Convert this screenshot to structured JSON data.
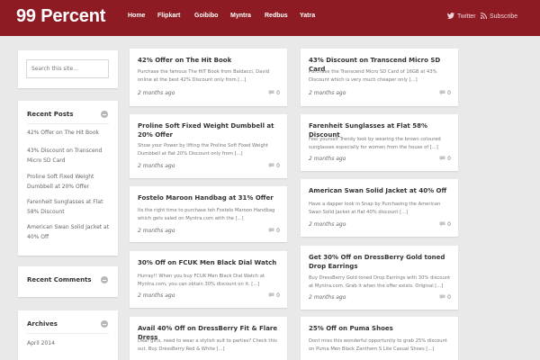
{
  "site": {
    "title": "99 Percent"
  },
  "nav": [
    "Home",
    "Flipkart",
    "Goibibo",
    "Myntra",
    "Redbus",
    "Yatra"
  ],
  "social": {
    "twitter": "Twitter",
    "subscribe": "Subscribe"
  },
  "colors": {
    "header": "#8e1b23",
    "background": "#e9e9e9"
  },
  "search": {
    "placeholder": "Search this site..."
  },
  "sidebar": {
    "recent_posts": {
      "title": "Recent Posts",
      "items": [
        "42% Offer on The Hit Book",
        "43% Discount on Transcend Micro SD Card",
        "Proline Soft Fixed Weight Dumbbell at 20% Offer",
        "Farenheit Sunglasses at Flat 58% Discount",
        "American Swan Solid Jacket at 40% Off"
      ]
    },
    "recent_comments": {
      "title": "Recent Comments"
    },
    "archives": {
      "title": "Archives",
      "items": [
        "April 2014"
      ]
    }
  },
  "posts": [
    {
      "title": "42% Offer on The Hit Book",
      "excerpt": "Purchase the famous The HIT Book from Baldacci, David online at the best 42% Discount only from [...]",
      "date": "2 months ago",
      "comments": "0"
    },
    {
      "title": "43% Discount on Transcend Micro SD Card",
      "excerpt": "Purchase the Transcend Micro SD Card of 16GB at 43% Discount which is very much cheaper only [...]",
      "date": "2 months ago",
      "comments": "0"
    },
    {
      "title": "Proline Soft Fixed Weight Dumbbell at 20% Offer",
      "excerpt": "Show your Power by lifting the Proline Soft Fixed Weight Dumbbell at flat 20% Discount only from [...]",
      "date": "2 months ago",
      "comments": "0"
    },
    {
      "title": "Farenheit Sunglasses at Flat 58% Discount",
      "excerpt": "Feel yourself Trendy look by wearing the brown coloured sunglasses especially for women from the house of [...]",
      "date": "2 months ago",
      "comments": "0"
    },
    {
      "title": "Fostelo Maroon Handbag at 31% Offer",
      "excerpt": "Its the right time to purchase teh Fostelo Maroon Handbag which gets saled on Myntra.com with the [...]",
      "date": "2 months ago",
      "comments": "0"
    },
    {
      "title": "American Swan Solid Jacket at 40% Off",
      "excerpt": "Have a dapper look in Snap by Purchasing the American Swan Solid Jacket at flat 40% discount [...]",
      "date": "2 months ago",
      "comments": "0"
    },
    {
      "title": "30% Off on FCUK Men Black Dial Watch",
      "excerpt": "Hurray!! When you buy FCUK Men Black Dial Watch at Myntra.com, you can obtain 30% discount on it. [...]",
      "date": "2 months ago",
      "comments": "0"
    },
    {
      "title": "Get 30% Off on DressBerry Gold toned Drop Earrings",
      "excerpt": "Buy DressBerry Gold toned Drop Earrings with 30% discount at Myntra.com. Grab it when the offer exists. Original [...]",
      "date": "2 months ago",
      "comments": "0"
    },
    {
      "title": "Avail 40% Off on DressBerry Fit & Flare Dress",
      "excerpt": "Dear girls, need to wear a stylish suit to parties? Check this out. Buy DressBerry Red & White [...]"
    },
    {
      "title": "25% Off on Puma Shoes",
      "excerpt": "Dont miss this wonderful opportunity to grab 25% discount on Puma Men Black Zanthem S Lite Casual Shoes [...]"
    }
  ]
}
